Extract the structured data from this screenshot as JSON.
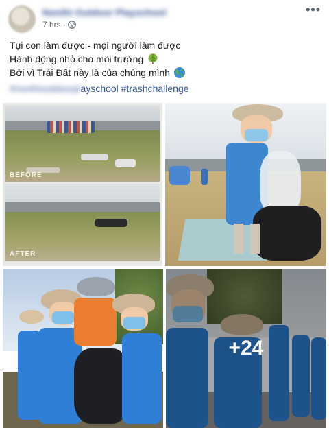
{
  "post": {
    "page_name": "Nonihi Outdoor Playschool",
    "time": "7 hrs",
    "privacy": "Public",
    "more_icon": "more-options-icon"
  },
  "content": {
    "lines": [
      "Tụi con làm được - mọi người làm được",
      "Hành động nhỏ cho môi trường",
      "Bởi vì Trái Đất này là của chúng mình"
    ],
    "emojis": [
      "tree-emoji",
      "earth-globe-emoji"
    ],
    "hashtag_blurred": "#nonihioutdoorpl",
    "hashtag_visible": "ayschool #trashchallenge"
  },
  "photos": {
    "before_label": "BEFORE",
    "after_label": "AFTER",
    "more_count": "+24"
  },
  "colors": {
    "link": "#385898",
    "meta": "#616770",
    "sky": "#c9d9ea",
    "grass": "#7d8a4a",
    "apron_blue": "#2f7fd6"
  }
}
